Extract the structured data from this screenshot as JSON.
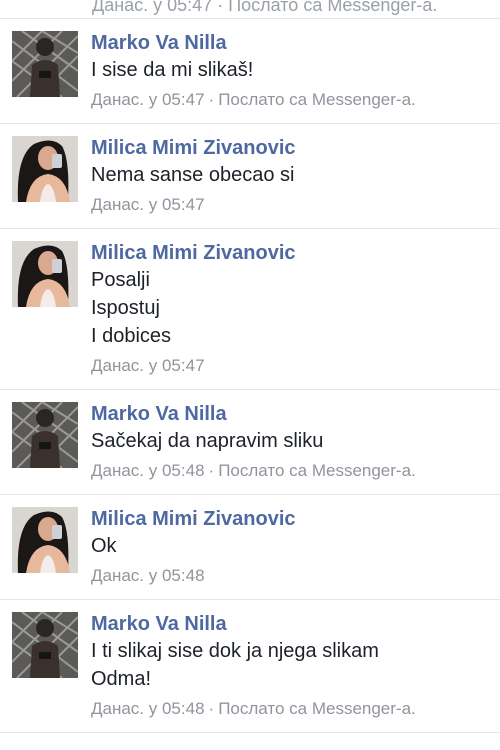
{
  "top_partial": {
    "meta": "Данас. у 05:47 · Послато са Messenger-а."
  },
  "messages": [
    {
      "sender": "Marko Va Nilla",
      "avatar_icon": "male-profile-photo",
      "lines": [
        "I sise da mi slikaš!"
      ],
      "time": "Данас. у 05:47",
      "source": "Послато са Messenger-а."
    },
    {
      "sender": "Milica Mimi Zivanovic",
      "avatar_icon": "female-profile-photo",
      "lines": [
        "Nema sanse obecao si"
      ],
      "time": "Данас. у 05:47",
      "source": ""
    },
    {
      "sender": "Milica Mimi Zivanovic",
      "avatar_icon": "female-profile-photo",
      "lines": [
        "Posalji",
        "Ispostuj",
        "I dobices"
      ],
      "time": "Данас. у 05:47",
      "source": ""
    },
    {
      "sender": "Marko Va Nilla",
      "avatar_icon": "male-profile-photo",
      "lines": [
        "Sačekaj da napravim sliku"
      ],
      "time": "Данас. у 05:48",
      "source": "Послато са Messenger-а."
    },
    {
      "sender": "Milica Mimi Zivanovic",
      "avatar_icon": "female-profile-photo",
      "lines": [
        "Ok"
      ],
      "time": "Данас. у 05:48",
      "source": ""
    },
    {
      "sender": "Marko Va Nilla",
      "avatar_icon": "male-profile-photo",
      "lines": [
        "I ti slikaj sise dok ja njega slikam",
        "Odma!"
      ],
      "time": "Данас. у 05:48",
      "source": "Послато са Messenger-а."
    }
  ],
  "colors": {
    "sender_name": "#4e69a2",
    "message_text": "#1d2129",
    "meta_text": "#90949c",
    "divider": "#e6e6e6"
  }
}
